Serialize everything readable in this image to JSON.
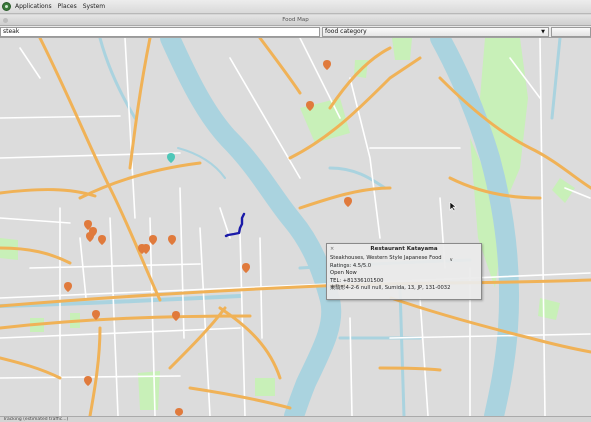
{
  "topbar": {
    "menus": [
      "Applications",
      "Places",
      "System"
    ]
  },
  "window": {
    "title": "Food Map"
  },
  "search": {
    "query": "steak",
    "category": "food category"
  },
  "popup": {
    "title": "Restaurant Katayama",
    "categories": "Steakhouses, Western Style Japanese Food",
    "rating": "Ratings: 4.5/5.0",
    "status": "Open Now",
    "phone": "TEL: +81336101500",
    "address": "東駒形4-2-6 null null, Sumida, 13, JP, 131-0032"
  },
  "status": {
    "text": "Tracking (estimated traffic...)"
  },
  "colors": {
    "road_major": "#f0b257",
    "road_minor": "#ffffff",
    "water": "#aad3df",
    "park": "#c8f0b8",
    "route": "#1a1aa8",
    "marker": "#e07a3c"
  }
}
